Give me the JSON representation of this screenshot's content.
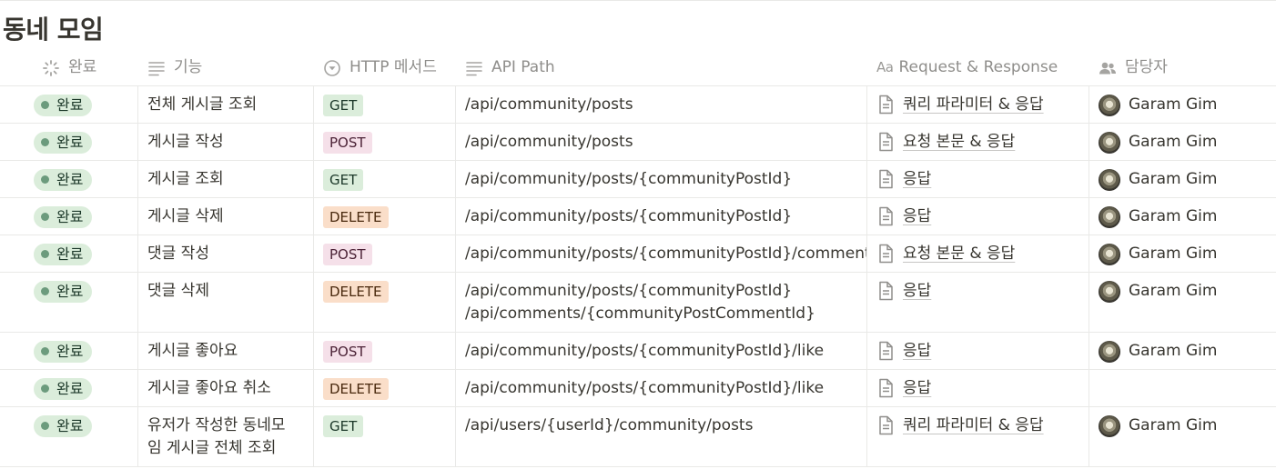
{
  "database": {
    "title": "동네 모임"
  },
  "columns": {
    "status": "완료",
    "feature": "기능",
    "method": "HTTP 메서드",
    "path": "API Path",
    "request_prefix": "Aa",
    "request": "Request & Response",
    "owner": "담당자"
  },
  "colors": {
    "status_done_bg": "#dbeddb",
    "status_done_dot": "#6c9b7d",
    "get_bg": "#dbeddb",
    "post_bg": "#f5e0e9",
    "delete_bg": "#fadec9"
  },
  "icons": {
    "status_column": "loading-spinner-icon",
    "text_column": "text-lines-icon",
    "select_column": "select-circle-icon",
    "person_column": "people-icon",
    "page": "document-icon",
    "avatar": "user-avatar"
  },
  "rows": [
    {
      "status": "완료",
      "feature": [
        "전체 게시글 조회"
      ],
      "method": "GET",
      "path": [
        "/api/community/posts"
      ],
      "request": "쿼리 파라미터 & 응답",
      "owner": "Garam Gim"
    },
    {
      "status": "완료",
      "feature": [
        "게시글 작성"
      ],
      "method": "POST",
      "path": [
        "/api/community/posts"
      ],
      "request": "요청 본문 & 응답",
      "owner": "Garam Gim"
    },
    {
      "status": "완료",
      "feature": [
        "게시글 조회"
      ],
      "method": "GET",
      "path": [
        "/api/community/posts/{communityPostId}"
      ],
      "request": "응답",
      "owner": "Garam Gim"
    },
    {
      "status": "완료",
      "feature": [
        "게시글 삭제"
      ],
      "method": "DELETE",
      "path": [
        "/api/community/posts/{communityPostId}"
      ],
      "request": "응답",
      "owner": "Garam Gim"
    },
    {
      "status": "완료",
      "feature": [
        "댓글 작성"
      ],
      "method": "POST",
      "path": [
        "/api/community/posts/{communityPostId}/comments/"
      ],
      "request": "요청 본문 & 응답",
      "owner": "Garam Gim"
    },
    {
      "status": "완료",
      "feature": [
        "댓글 삭제"
      ],
      "method": "DELETE",
      "path": [
        "/api/community/posts/{communityPostId}",
        "/api/comments/{communityPostCommentId}"
      ],
      "request": "응답",
      "owner": "Garam Gim"
    },
    {
      "status": "완료",
      "feature": [
        "게시글 좋아요"
      ],
      "method": "POST",
      "path": [
        "/api/community/posts/{communityPostId}/like"
      ],
      "request": "응답",
      "owner": "Garam Gim"
    },
    {
      "status": "완료",
      "feature": [
        "게시글 좋아요 취소"
      ],
      "method": "DELETE",
      "path": [
        "/api/community/posts/{communityPostId}/like"
      ],
      "request": "응답",
      "owner": ""
    },
    {
      "status": "완료",
      "feature": [
        "유저가 작성한 동네모",
        "임 게시글 전체 조회"
      ],
      "method": "GET",
      "path": [
        "/api/users/{userId}/community/posts"
      ],
      "request": "쿼리 파라미터 & 응답",
      "owner": "Garam Gim"
    }
  ]
}
